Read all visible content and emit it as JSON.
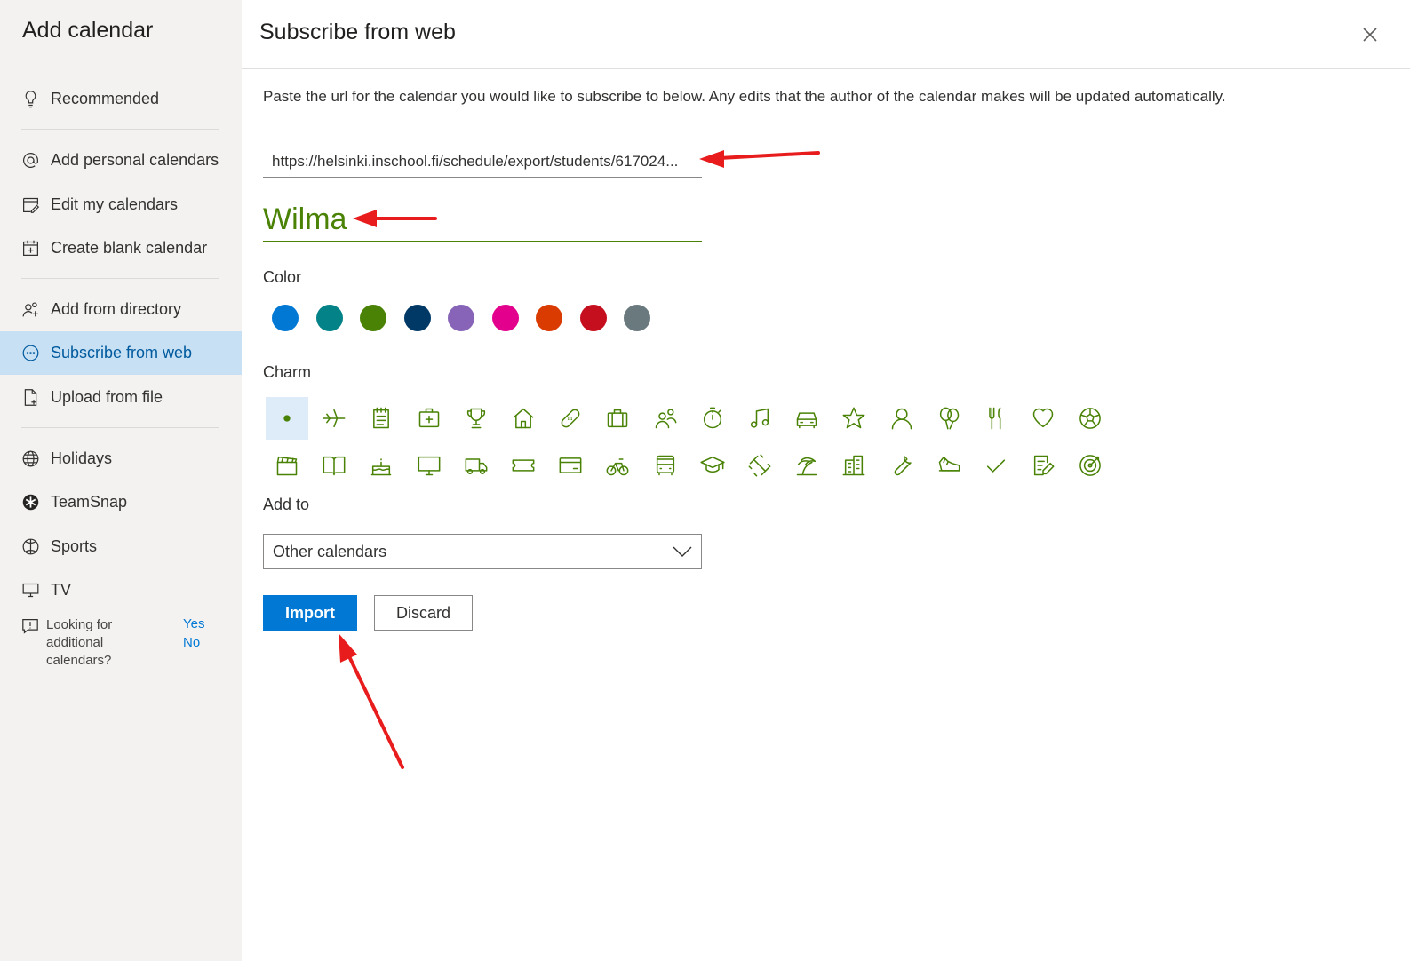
{
  "sidebar": {
    "title": "Add calendar",
    "items": [
      {
        "label": "Recommended",
        "icon": "lightbulb-icon"
      },
      {
        "label": "Add personal calendars",
        "icon": "at-sign-icon"
      },
      {
        "label": "Edit my calendars",
        "icon": "edit-calendar-icon"
      },
      {
        "label": "Create blank calendar",
        "icon": "calendar-add-icon"
      },
      {
        "label": "Add from directory",
        "icon": "people-add-icon"
      },
      {
        "label": "Subscribe from web",
        "icon": "more-circle-icon",
        "active": true
      },
      {
        "label": "Upload from file",
        "icon": "file-icon"
      },
      {
        "label": "Holidays",
        "icon": "globe-icon"
      },
      {
        "label": "TeamSnap",
        "icon": "teamsnap-icon"
      },
      {
        "label": "Sports",
        "icon": "ball-icon"
      },
      {
        "label": "TV",
        "icon": "monitor-icon"
      }
    ],
    "help": {
      "text": "Looking for additional calendars?",
      "yes": "Yes",
      "no": "No"
    }
  },
  "main": {
    "title": "Subscribe from web",
    "description": "Paste the url for the calendar you would like to subscribe to below. Any edits that the author of the calendar makes will be updated automatically.",
    "url_value": "https://helsinki.inschool.fi/schedule/export/students/617024...",
    "name_value": "Wilma",
    "color_label": "Color",
    "colors": [
      "#0078d4",
      "#038387",
      "#498205",
      "#003966",
      "#8764b8",
      "#e3008c",
      "#da3b01",
      "#c50f1f",
      "#69797e"
    ],
    "selected_color": "#498205",
    "charm_label": "Charm",
    "charms": [
      "dot",
      "airplane",
      "notepad",
      "medical-kit",
      "trophy",
      "home",
      "bandage",
      "briefcase",
      "people",
      "stopwatch",
      "music-note",
      "car",
      "star",
      "person",
      "balloons",
      "fork-knife",
      "heart",
      "soccer-ball",
      "clapperboard",
      "book",
      "birthday-cake",
      "monitor",
      "truck",
      "ticket",
      "credit-card",
      "bicycle",
      "bus",
      "graduation-cap",
      "dumbbell",
      "beach",
      "building",
      "wrench",
      "running-shoe",
      "checkmark",
      "notes-edit",
      "target"
    ],
    "add_to_label": "Add to",
    "add_to_value": "Other calendars",
    "import_label": "Import",
    "discard_label": "Discard",
    "accent_color": "#0078d4",
    "charm_color": "#498205"
  }
}
